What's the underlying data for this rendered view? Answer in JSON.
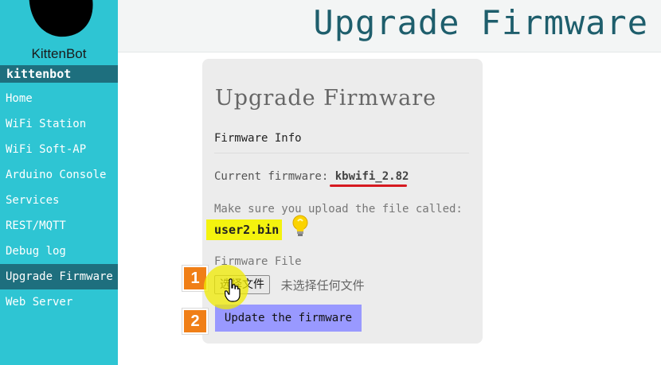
{
  "sidebar": {
    "logo_text": "KittenBot",
    "user": "kittenbot",
    "items": [
      {
        "label": "Home"
      },
      {
        "label": "WiFi Station"
      },
      {
        "label": "WiFi Soft-AP"
      },
      {
        "label": "Arduino Console"
      },
      {
        "label": "Services"
      },
      {
        "label": "REST/MQTT"
      },
      {
        "label": "Debug log"
      },
      {
        "label": "Upgrade Firmware",
        "active": true
      },
      {
        "label": "Web Server"
      }
    ]
  },
  "header": {
    "title": "Upgrade Firmware"
  },
  "card": {
    "title": "Upgrade Firmware",
    "section": "Firmware Info",
    "current_label": "Current firmware:",
    "current_version": "kbwifi_2.82",
    "make_sure": "Make sure you upload the file called:",
    "filename": "user2.bin",
    "file_label": "Firmware File",
    "choose_button": "选择文件",
    "no_file": "未选择任何文件",
    "update_button": "Update the firmware"
  },
  "annotations": {
    "step1": "1",
    "step2": "2"
  },
  "colors": {
    "sidebar": "#2ec5d3",
    "sidebar_active": "#1e6f7e",
    "header_title": "#1e5e6c",
    "update_button": "#9999ff",
    "highlight": "#f4f30e",
    "badge": "#f07f17",
    "underline": "#d71920"
  },
  "icons": [
    "logo-icon",
    "lightbulb-icon",
    "hand-cursor-icon"
  ]
}
